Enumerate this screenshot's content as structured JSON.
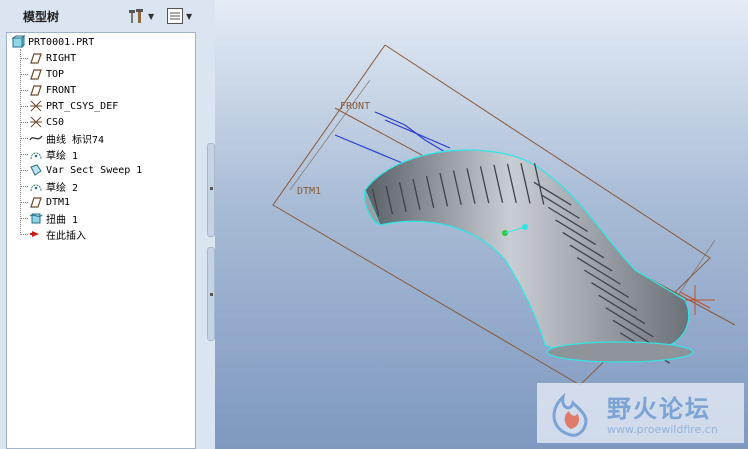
{
  "panel": {
    "title": "模型树",
    "tools": [
      {
        "icon": "tools-icon"
      },
      {
        "icon": "show-list-icon"
      }
    ]
  },
  "tree": {
    "root": {
      "label": "PRT0001.PRT",
      "icon": "part-icon"
    },
    "items": [
      {
        "label": "RIGHT",
        "icon": "datum-plane-icon"
      },
      {
        "label": "TOP",
        "icon": "datum-plane-icon"
      },
      {
        "label": "FRONT",
        "icon": "datum-plane-icon"
      },
      {
        "label": "PRT_CSYS_DEF",
        "icon": "coord-system-icon"
      },
      {
        "label": "CS0",
        "icon": "coord-system-icon"
      },
      {
        "label": "曲线 标识74",
        "icon": "curve-icon"
      },
      {
        "label": "草绘 1",
        "icon": "sketch-icon"
      },
      {
        "label": "Var Sect Sweep 1",
        "icon": "sweep-icon"
      },
      {
        "label": "草绘 2",
        "icon": "sketch-icon"
      },
      {
        "label": "DTM1",
        "icon": "datum-plane-icon"
      },
      {
        "label": "扭曲 1",
        "icon": "warp-icon"
      },
      {
        "label": "在此插入",
        "icon": "insert-here-icon"
      }
    ]
  },
  "viewport": {
    "datum_labels": [
      "FRONT",
      "DTM1"
    ],
    "model": "bellows-sweep-model"
  },
  "watermark": {
    "title": "野火论坛",
    "url": "www.proewildfire.cn"
  },
  "colors": {
    "panel_bg": "#dbe5f1",
    "model_edge": "#2ee6e6",
    "datum": "#8a5a3a",
    "curve": "#2a3fd6"
  }
}
